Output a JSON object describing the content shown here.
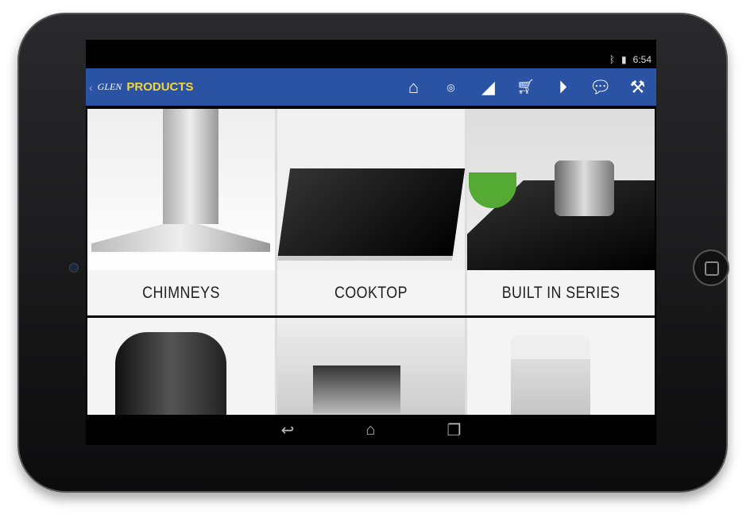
{
  "status": {
    "time": "6:54"
  },
  "header": {
    "logo": "GLEN",
    "title": "PRODUCTS"
  },
  "toolbar": [
    "home-icon",
    "glen-logo-icon",
    "megaphone-icon",
    "cart-icon",
    "play-icon",
    "chat-icon",
    "tools-icon"
  ],
  "products": [
    {
      "label": "CHIMNEYS"
    },
    {
      "label": "COOKTOP"
    },
    {
      "label": "BUILT IN SERIES"
    }
  ],
  "colors": {
    "header": "#2a53a3",
    "title": "#f3d53c"
  }
}
